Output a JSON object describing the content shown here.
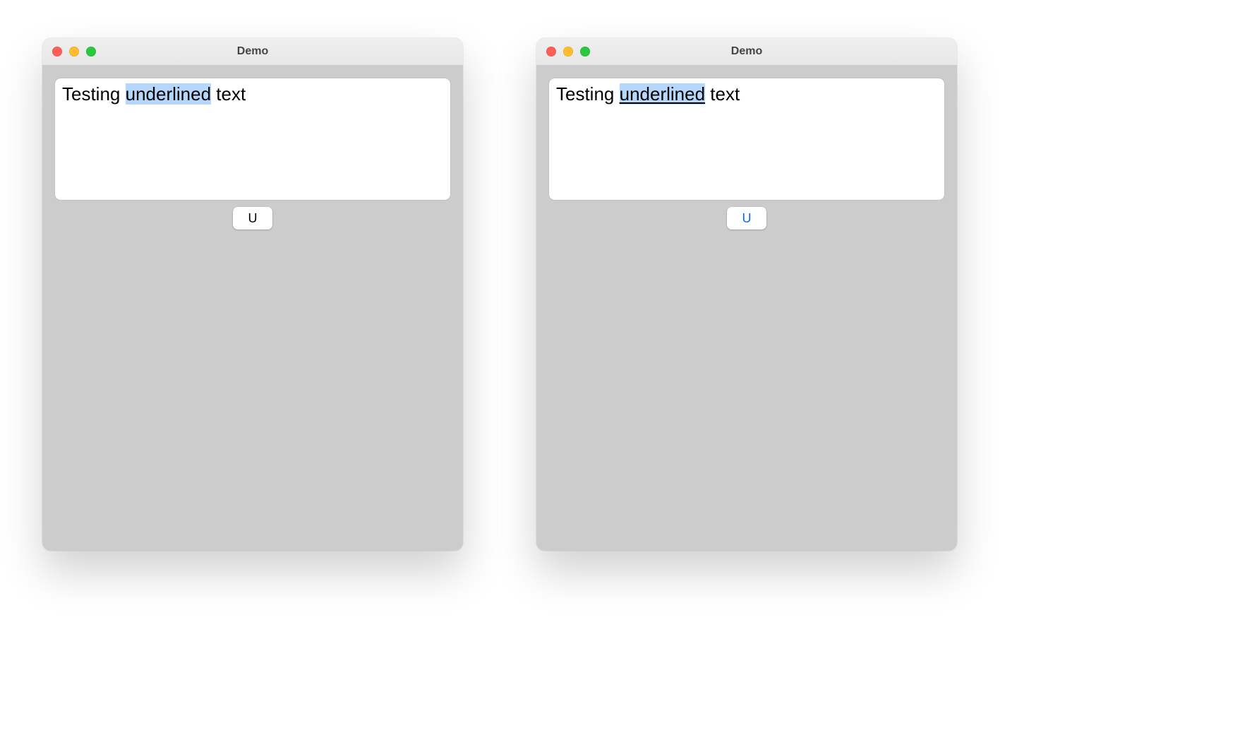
{
  "windows": [
    {
      "title": "Demo",
      "text": {
        "before": "Testing ",
        "selected": "underlined",
        "after": " text",
        "selected_underlined": false
      },
      "button": {
        "label": "U",
        "active": false
      }
    },
    {
      "title": "Demo",
      "text": {
        "before": "Testing ",
        "selected": "underlined",
        "after": " text",
        "selected_underlined": true
      },
      "button": {
        "label": "U",
        "active": true
      }
    }
  ],
  "colors": {
    "window_bg": "#cccccc",
    "selection": "#b6d7fc",
    "accent": "#0a63ff",
    "traffic_red": "#ff5f57",
    "traffic_yellow": "#febc2e",
    "traffic_green": "#28c840"
  }
}
